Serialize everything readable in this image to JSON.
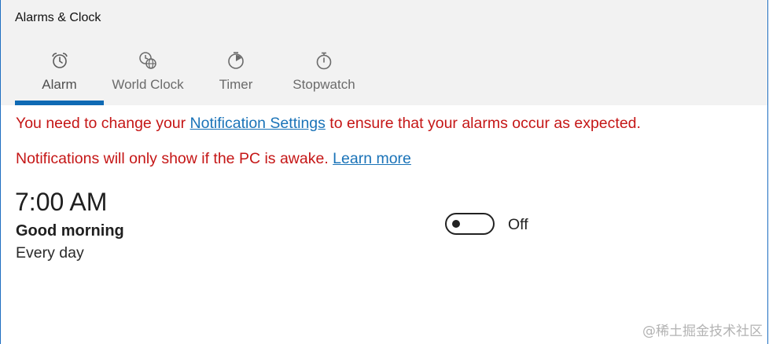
{
  "window": {
    "title": "Alarms & Clock"
  },
  "tabs": [
    {
      "label": "Alarm",
      "icon": "alarm-clock-icon",
      "active": true
    },
    {
      "label": "World Clock",
      "icon": "world-clock-icon",
      "active": false
    },
    {
      "label": "Timer",
      "icon": "timer-icon",
      "active": false
    },
    {
      "label": "Stopwatch",
      "icon": "stopwatch-icon",
      "active": false
    }
  ],
  "notices": {
    "line1_before": "You need to change your ",
    "line1_link": "Notification Settings",
    "line1_after": " to ensure that your alarms occur as expected.",
    "line2_text": "Notifications will only show if the PC is awake. ",
    "line2_link": "Learn more"
  },
  "alarm": {
    "time": "7:00 AM",
    "name": "Good morning",
    "repeat": "Every day",
    "toggle_state": "Off"
  },
  "watermark": "@稀土掘金技术社区",
  "colors": {
    "accent": "#0f6ab4",
    "warning": "#c51616",
    "link": "#1a73b8",
    "chrome_bg": "#f2f2f2"
  }
}
